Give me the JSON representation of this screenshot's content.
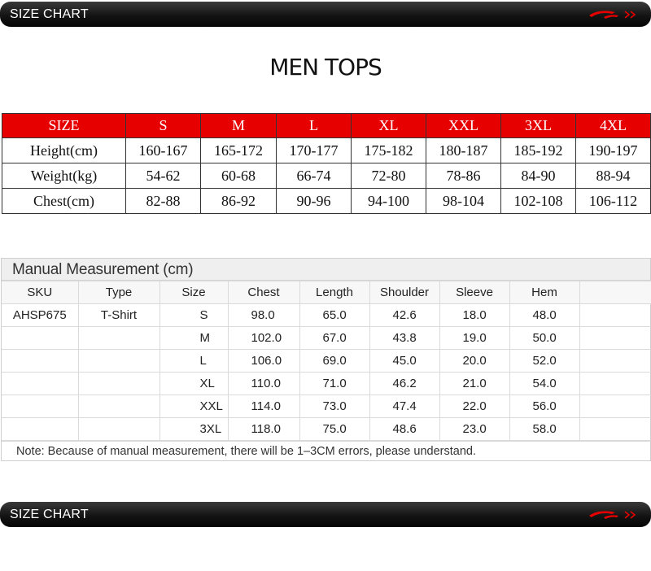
{
  "header": {
    "title": "SIZE CHART",
    "logo_icon": "brand-logo-icon",
    "accent": "#e60000"
  },
  "main_title": "MEN TOPS",
  "size_table": {
    "header_label": "SIZE",
    "sizes": [
      "S",
      "M",
      "L",
      "XL",
      "XXL",
      "3XL",
      "4XL"
    ],
    "rows": [
      {
        "label": "Height(cm)",
        "values": [
          "160-167",
          "165-172",
          "170-177",
          "175-182",
          "180-187",
          "185-192",
          "190-197"
        ]
      },
      {
        "label": "Weight(kg)",
        "values": [
          "54-62",
          "60-68",
          "66-74",
          "72-80",
          "78-86",
          "84-90",
          "88-94"
        ]
      },
      {
        "label": "Chest(cm)",
        "values": [
          "82-88",
          "86-92",
          "90-96",
          "94-100",
          "98-104",
          "102-108",
          "106-112"
        ]
      }
    ]
  },
  "manual": {
    "title": "Manual Measurement (cm)",
    "columns": [
      "SKU",
      "Type",
      "Size",
      "Chest",
      "Length",
      "Shoulder",
      "Sleeve",
      "Hem",
      ""
    ],
    "rows": [
      {
        "sku": "AHSP675",
        "type": "T-Shirt",
        "size": "S",
        "chest": "98.0",
        "length": "65.0",
        "shoulder": "42.6",
        "sleeve": "18.0",
        "hem": "48.0"
      },
      {
        "sku": "",
        "type": "",
        "size": "M",
        "chest": "102.0",
        "length": "67.0",
        "shoulder": "43.8",
        "sleeve": "19.0",
        "hem": "50.0"
      },
      {
        "sku": "",
        "type": "",
        "size": "L",
        "chest": "106.0",
        "length": "69.0",
        "shoulder": "45.0",
        "sleeve": "20.0",
        "hem": "52.0"
      },
      {
        "sku": "",
        "type": "",
        "size": "XL",
        "chest": "110.0",
        "length": "71.0",
        "shoulder": "46.2",
        "sleeve": "21.0",
        "hem": "54.0"
      },
      {
        "sku": "",
        "type": "",
        "size": "XXL",
        "chest": "114.0",
        "length": "73.0",
        "shoulder": "47.4",
        "sleeve": "22.0",
        "hem": "56.0"
      },
      {
        "sku": "",
        "type": "",
        "size": "3XL",
        "chest": "118.0",
        "length": "75.0",
        "shoulder": "48.6",
        "sleeve": "23.0",
        "hem": "58.0"
      }
    ],
    "note": "Note: Because of manual measurement, there will be 1–3CM errors, please understand."
  },
  "footer": {
    "title": "SIZE CHART",
    "logo_icon": "brand-logo-icon"
  }
}
